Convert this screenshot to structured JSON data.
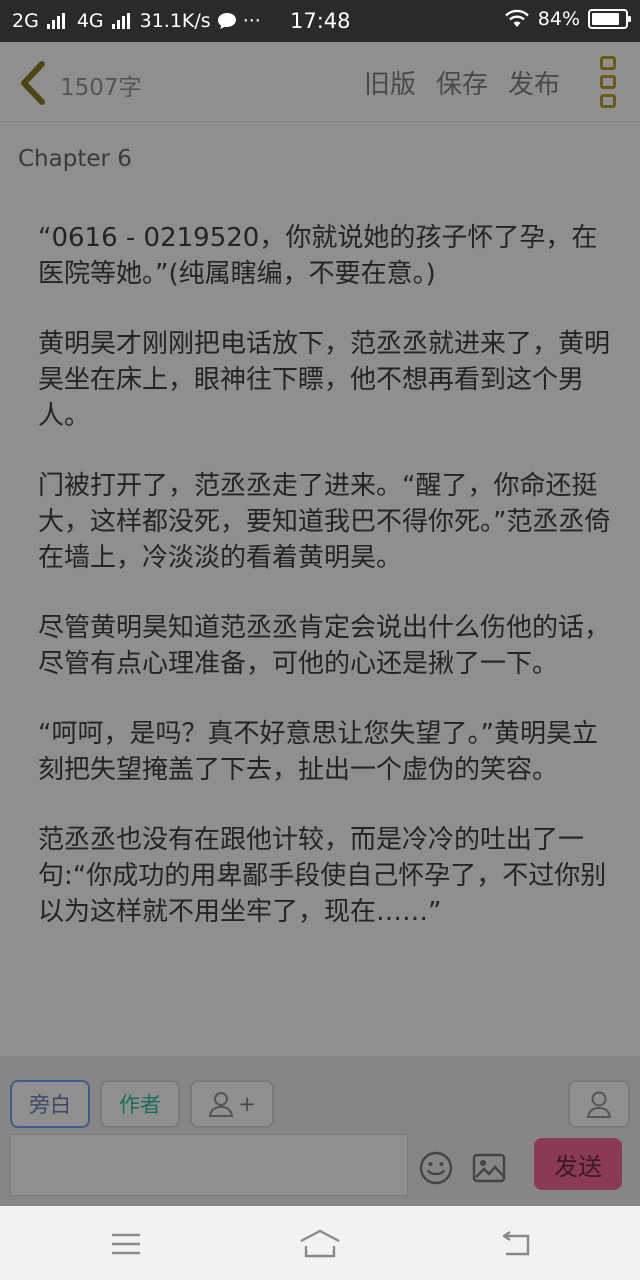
{
  "status_bar": {
    "network_1": "2G",
    "network_2": "4G",
    "speed": "31.1K/s",
    "more": "···",
    "time": "17:48",
    "battery": "84%",
    "battery_level": 0.84
  },
  "toolbar": {
    "word_count": "1507字",
    "old_version": "旧版",
    "save": "保存",
    "publish": "发布"
  },
  "chapter": "Chapter  6",
  "paragraphs": [
    "“0616 - 0219520，你就说她的孩子怀了孕，在医院等她。”(纯属瞎编，不要在意。)",
    "黄明昊才刚刚把电话放下，范丞丞就进来了，黄明昊坐在床上，眼神往下瞟，他不想再看到这个男人。",
    "门被打开了，范丞丞走了进来。“醒了，你命还挺大，这样都没死，要知道我巴不得你死。”范丞丞倚在墙上，冷淡淡的看着黄明昊。",
    "尽管黄明昊知道范丞丞肯定会说出什么伤他的话，尽管有点心理准备，可他的心还是揪了一下。",
    "“呵呵，是吗？真不好意思让您失望了。”黄明昊立刻把失望掩盖了下去，扯出一个虚伪的笑容。",
    "范丞丞也没有在跟他计较，而是冷冷的吐出了一句:“你成功的用卑鄙手段使自己怀孕了，不过你别以为这样就不用坐牢了，现在……”"
  ],
  "panel": {
    "narration": "旁白",
    "author": "作者",
    "add_role": "+",
    "input_value": "",
    "send": "发送"
  },
  "colors": {
    "overlay": "#8f8f8f",
    "send_bg": "#8a3a57",
    "author_text": "#1e6b5f"
  }
}
